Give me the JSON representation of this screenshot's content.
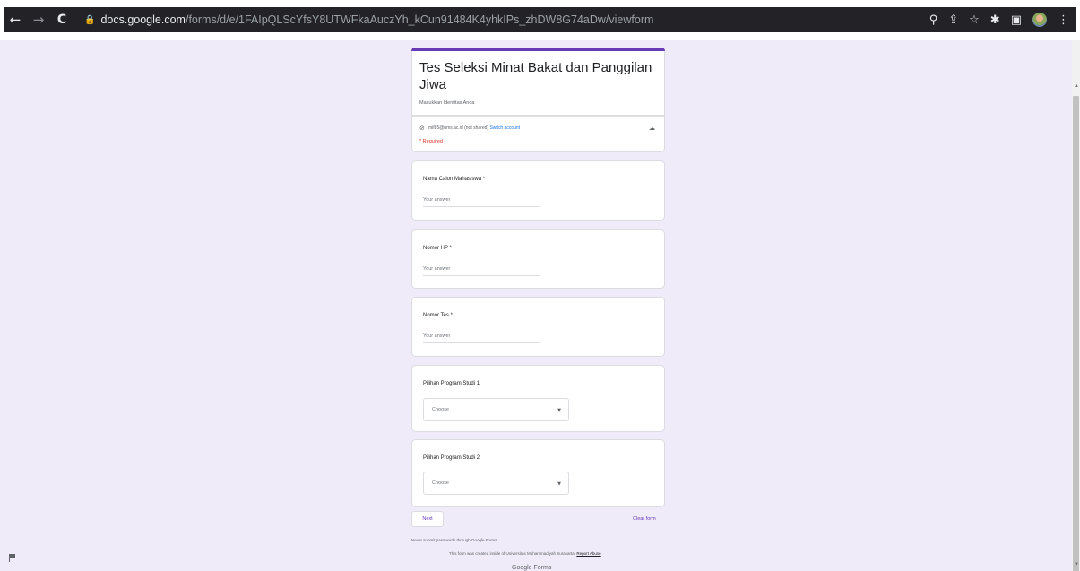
{
  "browser": {
    "url_host": "docs.google.com",
    "url_path": "/forms/d/e/1FAIpQLScYfsY8UTWFkaAuczYh_kCun91484K4yhkIPs_zhDW8G74aDw/viewform",
    "icons": [
      "zoom-icon",
      "share-icon",
      "star-icon",
      "extensions-icon",
      "sidebar-icon",
      "profile-avatar",
      "menu-icon"
    ]
  },
  "form": {
    "title": "Tes Seleksi Minat Bakat dan Panggilan Jiwa",
    "description": "Masukkan Identitas Anda",
    "account_email": "mif85@ums.ac.id",
    "not_shared": "(not shared)",
    "switch_account": "Switch account",
    "required_note": "* Required",
    "questions": [
      {
        "label": "Nama Calon Mahasiswa *",
        "placeholder": "Your answer"
      },
      {
        "label": "Nomor HP *",
        "placeholder": "Your answer"
      },
      {
        "label": "Nomor Tes *",
        "placeholder": "Your answer"
      },
      {
        "label": "Pilihan Program Studi 1",
        "selected": "Choose"
      },
      {
        "label": "Pilihan Program Studi 2",
        "selected": "Choose"
      }
    ],
    "next_label": "Next",
    "clear_label": "Clear form",
    "footer_warning": "Never submit passwords through Google Forms.",
    "footer_created": "This form was created inside of Universitas Muhammadiyah Surakarta.",
    "report_abuse": "Report Abuse",
    "brand": "Google Forms"
  },
  "colors": {
    "accent": "#673ab7",
    "page_bg": "#f0ebf8",
    "required": "#d93025",
    "link": "#1a73e8"
  }
}
